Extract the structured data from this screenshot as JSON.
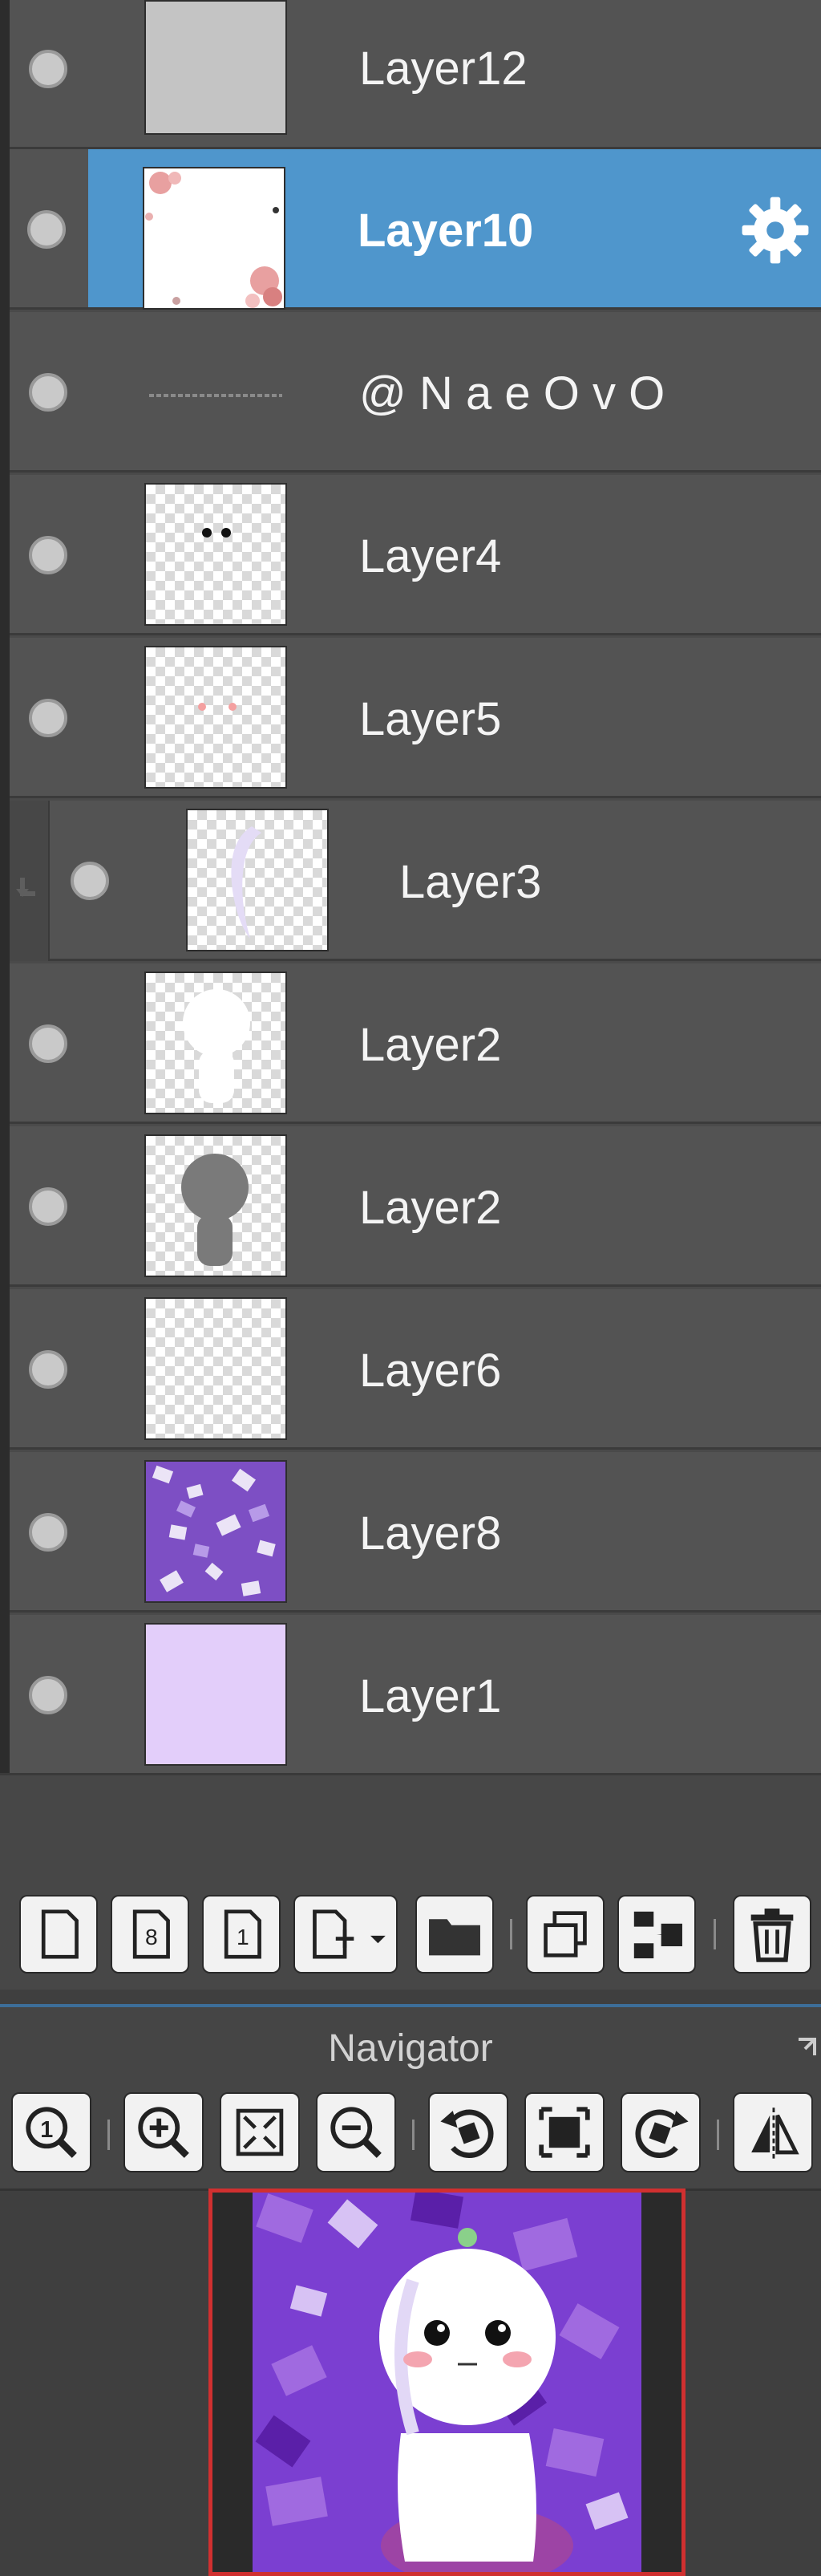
{
  "layers": [
    {
      "name": "Layer12"
    },
    {
      "name": "Layer10",
      "selected": true
    },
    {
      "name": "@ N a e O v O"
    },
    {
      "name": "Layer4"
    },
    {
      "name": "Layer5"
    },
    {
      "name": "Layer3",
      "clipped": true
    },
    {
      "name": "Layer2"
    },
    {
      "name": "Layer2"
    },
    {
      "name": "Layer6"
    },
    {
      "name": "Layer8"
    },
    {
      "name": "Layer1"
    }
  ],
  "layer_toolbar": {
    "icons": [
      "new-layer-icon",
      "new-layer-8bit-icon",
      "new-layer-1bit-icon",
      "new-special-layer-icon",
      "new-folder-icon",
      "duplicate-layer-icon",
      "merge-down-icon",
      "delete-layer-icon"
    ]
  },
  "navigator": {
    "title": "Navigator",
    "icons": [
      "zoom-actual-icon",
      "zoom-in-icon",
      "fit-to-window-icon",
      "zoom-out-icon",
      "rotate-left-icon",
      "reset-rotation-icon",
      "rotate-right-icon",
      "flip-horizontal-icon"
    ]
  },
  "colors": {
    "panel": "#535353",
    "selected": "#4f96cc",
    "text": "#f4f4f4",
    "navigator_frame": "#d03030"
  }
}
